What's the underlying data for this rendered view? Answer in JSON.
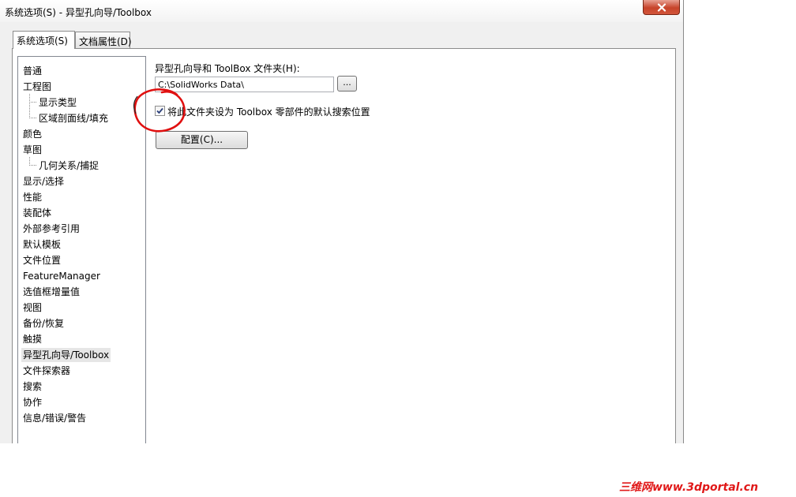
{
  "window": {
    "title": "系统选项(S) - 异型孔向导/Toolbox"
  },
  "tabs": [
    {
      "label": "系统选项(S)",
      "active": true
    },
    {
      "label": "文档属性(D)",
      "active": false
    }
  ],
  "tree": {
    "items": [
      {
        "label": "普通"
      },
      {
        "label": "工程图"
      },
      {
        "label": "显示类型"
      },
      {
        "label": "区域剖面线/填充"
      },
      {
        "label": "颜色"
      },
      {
        "label": "草图"
      },
      {
        "label": "几何关系/捕捉"
      },
      {
        "label": "显示/选择"
      },
      {
        "label": "性能"
      },
      {
        "label": "装配体"
      },
      {
        "label": "外部参考引用"
      },
      {
        "label": "默认模板"
      },
      {
        "label": "文件位置"
      },
      {
        "label": "FeatureManager"
      },
      {
        "label": "选值框增量值"
      },
      {
        "label": "视图"
      },
      {
        "label": "备份/恢复"
      },
      {
        "label": "触摸"
      },
      {
        "label": "异型孔向导/Toolbox",
        "selected": true
      },
      {
        "label": "文件探索器"
      },
      {
        "label": "搜索"
      },
      {
        "label": "协作"
      },
      {
        "label": "信息/错误/警告"
      }
    ]
  },
  "settings": {
    "folder_label": "异型孔向导和 ToolBox 文件夹(H):",
    "folder_value": "C:\\SolidWorks Data\\",
    "browse_label": "...",
    "default_search_label": "将此文件夹设为 Toolbox 零部件的默认搜索位置",
    "default_search_checked": true,
    "configure_label": "配置(C)..."
  },
  "annotation": {
    "color": "#e01010"
  },
  "watermark": {
    "text": "三维网www.3dportal.cn",
    "color": "#e01818"
  }
}
